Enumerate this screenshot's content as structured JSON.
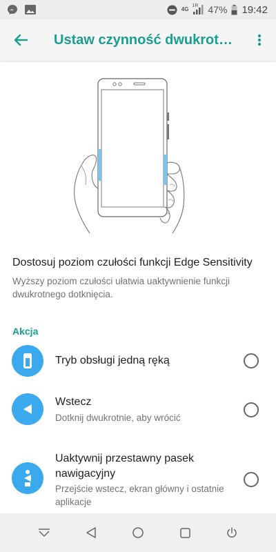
{
  "status_bar": {
    "left_icons": [
      "messenger-icon",
      "image-icon"
    ],
    "right_icons": [
      "do-not-disturb-icon",
      "4g-icon",
      "signal-icon",
      "battery-icon"
    ],
    "network": "4G",
    "sim": "1R",
    "battery": "47%",
    "time": "19:42"
  },
  "app_bar": {
    "title": "Ustaw czynność dwukrotnego dotknięcia"
  },
  "preference": {
    "title": "Dostosuj poziom czułości funkcji Edge Sensitivity",
    "summary": "Wyższy poziom czułości ułatwia uaktywnienie funkcji dwukrotnego dotknięcia."
  },
  "section": {
    "header": "Akcja"
  },
  "options": [
    {
      "title": "Tryb obsługi jedną ręką",
      "subtitle": "",
      "icon": "one-hand-mode-icon",
      "selected": false
    },
    {
      "title": "Wstecz",
      "subtitle": "Dotknij dwukrotnie, aby wrócić",
      "icon": "back-triangle-icon",
      "selected": false
    },
    {
      "title": "Uaktywnij przestawny pasek nawigacyjny",
      "subtitle": "Przejście wstecz, ekran główny i ostatnie aplikacje",
      "icon": "floating-nav-icon",
      "selected": false
    }
  ],
  "nav_bar": {
    "buttons": [
      "hide-nav-icon",
      "back-icon",
      "home-icon",
      "recents-icon",
      "power-icon"
    ]
  },
  "colors": {
    "accent": "#1a9e8f",
    "option_icon_bg": "#3aa9ee",
    "edge_highlight": "#7fc3ec"
  }
}
